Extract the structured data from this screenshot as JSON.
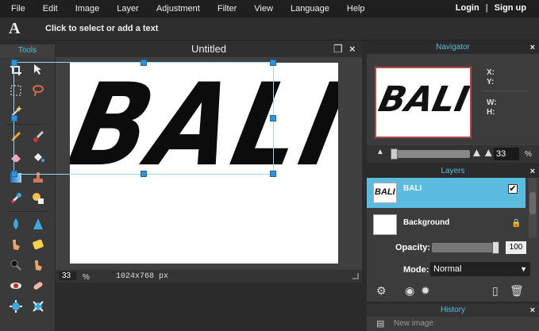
{
  "menubar": {
    "items": [
      "File",
      "Edit",
      "Image",
      "Layer",
      "Adjustment",
      "Filter",
      "View",
      "Language",
      "Help"
    ],
    "login": "Login",
    "separator": "|",
    "signup": "Sign up"
  },
  "options_bar": {
    "tool_glyph": "A",
    "hint": "Click to select or add a text"
  },
  "tools_panel": {
    "title": "Tools",
    "icons": [
      "move-icon",
      "crop-icon",
      "marquee-icon",
      "lasso-icon",
      "wand-icon",
      "pencil-icon",
      "brush-icon",
      "eraser-icon",
      "fill-bucket-icon",
      "gradient-icon",
      "stamp-icon",
      "color-replace-icon",
      "drawing-icon",
      "blur-icon",
      "sharpen-icon",
      "smudge-icon",
      "sponge-icon",
      "dodge-icon",
      "burn-icon",
      "red-eye-icon",
      "spot-heal-icon",
      "bloat-icon",
      "pinch-icon"
    ]
  },
  "document": {
    "title": "Untitled",
    "canvas_text": "BALI",
    "zoom": "33",
    "zoom_unit": "%",
    "size": "1024x768 px"
  },
  "navigator": {
    "title": "Navigator",
    "close": "×",
    "x_label": "X:",
    "y_label": "Y:",
    "w_label": "W:",
    "h_label": "H:",
    "zoom": "33",
    "zoom_unit": "%"
  },
  "layers": {
    "title": "Layers",
    "close": "×",
    "items": [
      {
        "label": "BALI",
        "selected": true,
        "visible": true
      },
      {
        "label": "Background",
        "selected": false,
        "locked": true
      }
    ],
    "opacity_label": "Opacity:",
    "opacity_value": "100",
    "opacity_level": 1.0,
    "mode_label": "Mode:",
    "mode_value": "Normal"
  },
  "history": {
    "title": "History",
    "close": "×",
    "item": "New image"
  },
  "colors": {
    "accent": "#5bbcdf",
    "selection": "#2f93d6"
  }
}
